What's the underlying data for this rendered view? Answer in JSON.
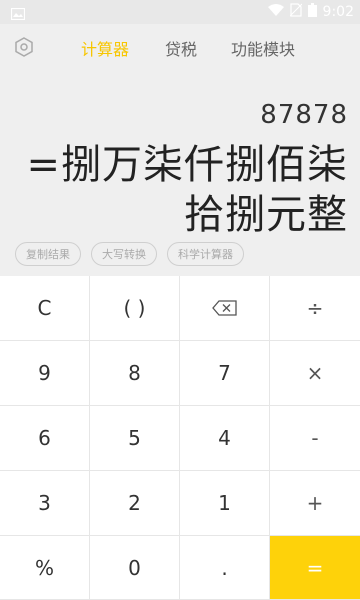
{
  "status_bar": {
    "time": "9:02",
    "icons": [
      "image-icon",
      "wifi-icon",
      "no-sim-icon",
      "battery-icon"
    ]
  },
  "top_bar": {
    "settings_icon": "gear-icon",
    "tabs": [
      {
        "label": "计算器",
        "active": true
      },
      {
        "label": "贷税",
        "active": false
      },
      {
        "label": "功能模块",
        "active": false
      }
    ]
  },
  "display": {
    "expression": "87878",
    "result": "=捌万柒仟捌佰柒拾捌元整"
  },
  "actions": [
    {
      "label": "复制结果"
    },
    {
      "label": "大写转换"
    },
    {
      "label": "科学计算器"
    }
  ],
  "keypad": {
    "keys": [
      "C",
      "( )",
      "backspace",
      "÷",
      "9",
      "8",
      "7",
      "×",
      "6",
      "5",
      "4",
      "-",
      "3",
      "2",
      "1",
      "+",
      "%",
      "0",
      ".",
      "="
    ]
  },
  "colors": {
    "accent": "#f7c600",
    "equals_bg": "#fed20a",
    "background": "#efefef"
  }
}
